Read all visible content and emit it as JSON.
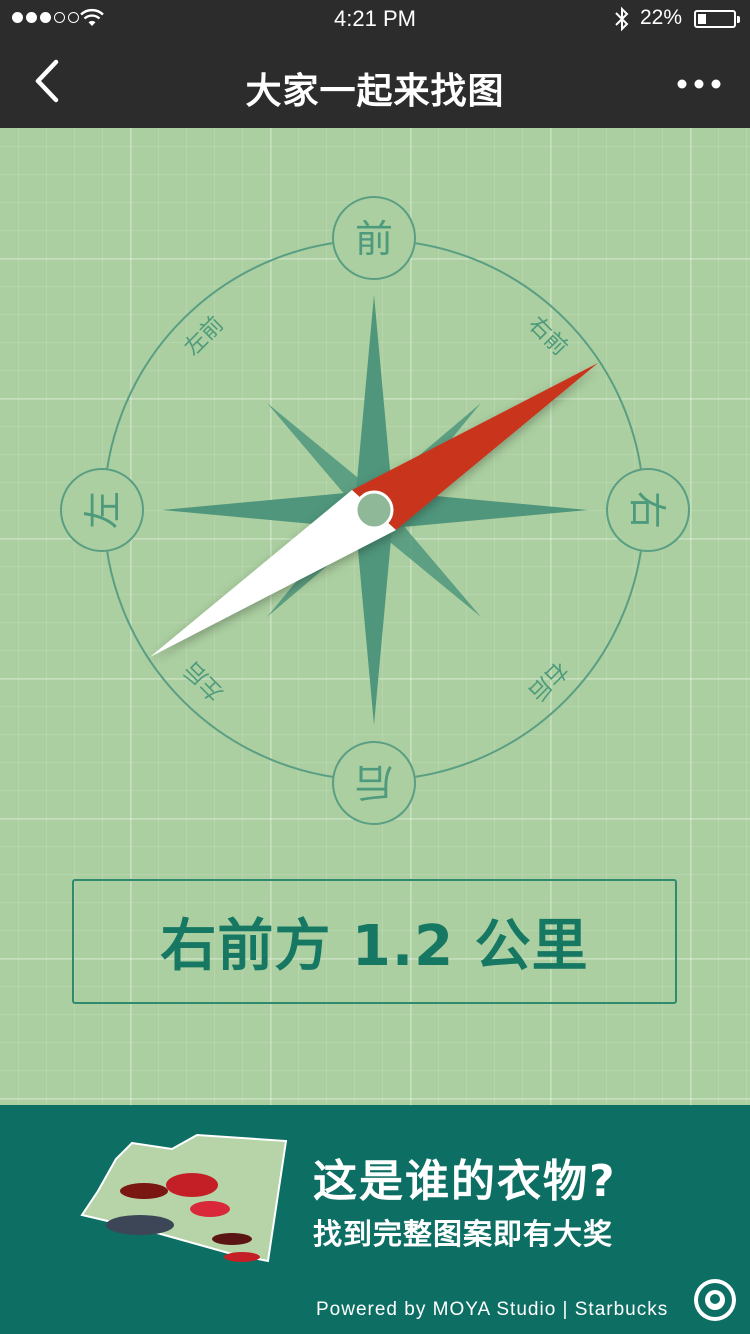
{
  "status_bar": {
    "time": "4:21 PM",
    "battery_percent": "22%",
    "signal_bars": 3,
    "battery_level": 0.22,
    "icons": [
      "signal-dots-icon",
      "wifi-icon",
      "bluetooth-icon",
      "battery-icon"
    ]
  },
  "nav": {
    "title": "大家一起来找图",
    "icons": [
      "back-chevron-icon",
      "more-dots-icon"
    ]
  },
  "compass": {
    "cardinal": {
      "front": "前",
      "left": "左",
      "right": "右",
      "back": "后"
    },
    "diagonal": {
      "front_right": "右前",
      "front_left": "左前",
      "back_right": "右后",
      "back_left": "左后"
    },
    "needle_heading": "右前",
    "colors": {
      "ring": "#5a9e84",
      "rose": "#4f967c",
      "needle_red": "#c8361f",
      "needle_white": "#ffffff"
    }
  },
  "distance": {
    "text": "右前方 1.2 公里"
  },
  "promo": {
    "headline": "这是谁的衣物?",
    "subline": "找到完整图案即有大奖",
    "image": "clothing-photo-fragment"
  },
  "footer": {
    "powered_by": "Powered by MOYA Studio | Starbucks",
    "logo": "starbucks-logo"
  },
  "colors": {
    "nav_bg": "#2c2c2c",
    "map_bg": "#abcfa0",
    "footer_bg": "#0d6f64",
    "distance_text": "#167863"
  }
}
